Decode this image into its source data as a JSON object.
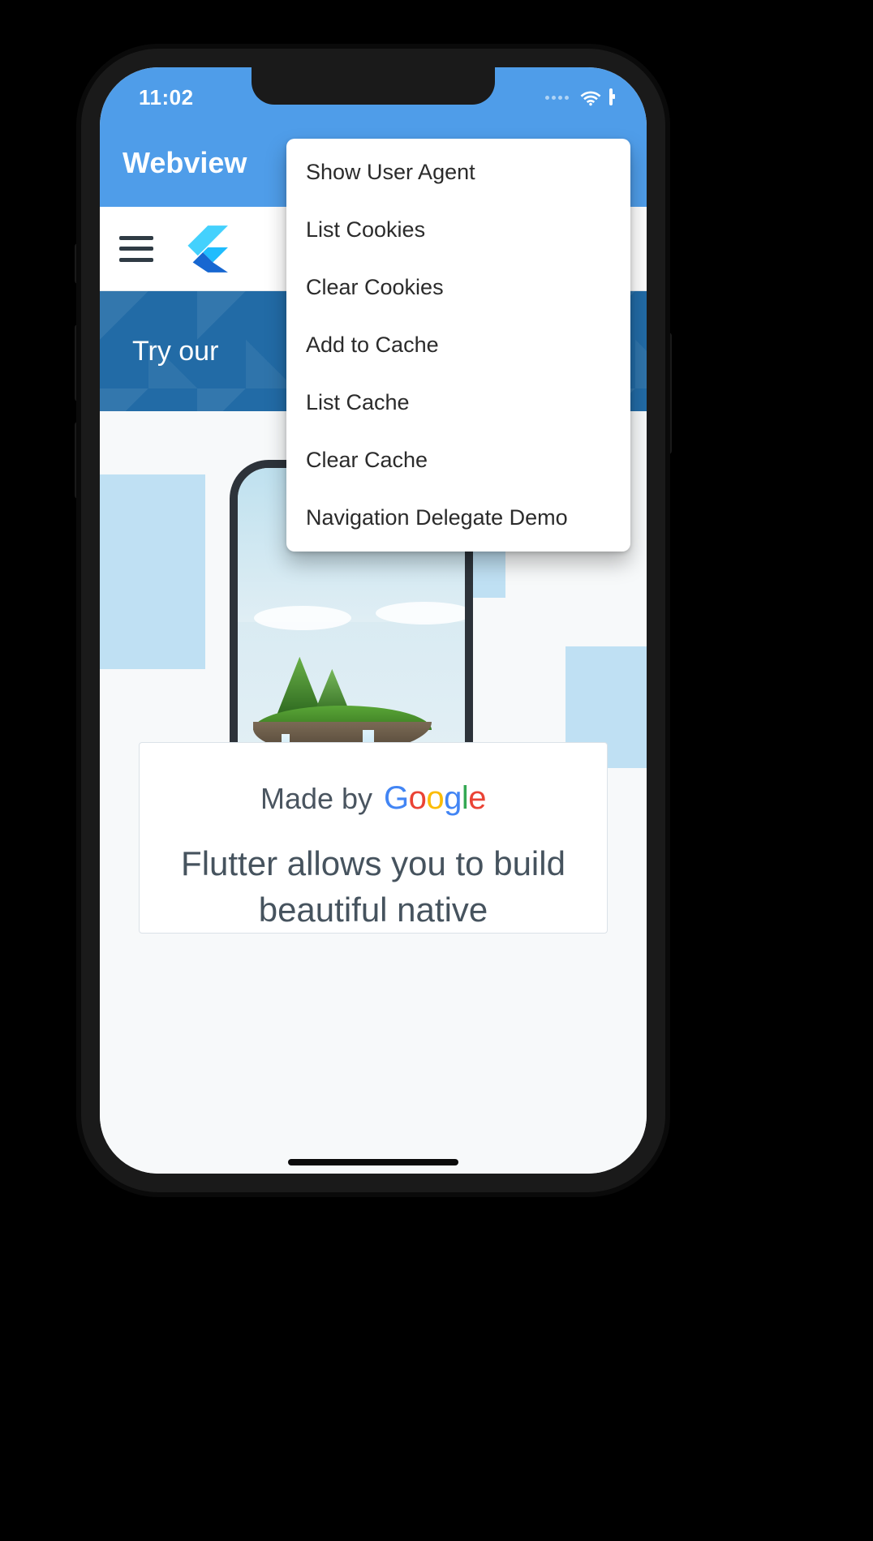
{
  "statusbar": {
    "time": "11:02"
  },
  "appbar": {
    "title": "Webview"
  },
  "webview": {
    "banner_text": "Try our",
    "card": {
      "made_by": "Made by",
      "brand_letters": [
        "G",
        "o",
        "o",
        "g",
        "l",
        "e"
      ],
      "tagline": "Flutter allows you to build beautiful native"
    }
  },
  "menu": {
    "items": [
      "Show User Agent",
      "List Cookies",
      "Clear Cookies",
      "Add to Cache",
      "List Cache",
      "Clear Cache",
      "Navigation Delegate Demo"
    ]
  }
}
